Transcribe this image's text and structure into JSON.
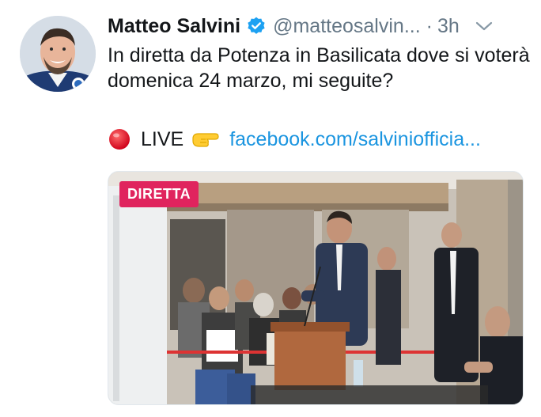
{
  "tweet": {
    "author_name": "Matteo Salvini",
    "handle": "@matteosalvin...",
    "separator": "·",
    "time": "3h",
    "text": "In diretta da Potenza in Basilicata dove si voterà domenica 24 marzo, mi seguite?",
    "live_label": "LIVE",
    "link_text": "facebook.com/salviniofficia...",
    "media_badge": "DIRETTA"
  },
  "icons": {
    "verified": "verified-badge-icon",
    "more": "chevron-down-icon",
    "live_dot": "red-circle-emoji",
    "pointer": "backhand-index-pointing-right-emoji"
  },
  "colors": {
    "text": "#14171a",
    "muted": "#657786",
    "link": "#1b95e0",
    "verified": "#1da1f2",
    "badge": "#e0245e"
  }
}
